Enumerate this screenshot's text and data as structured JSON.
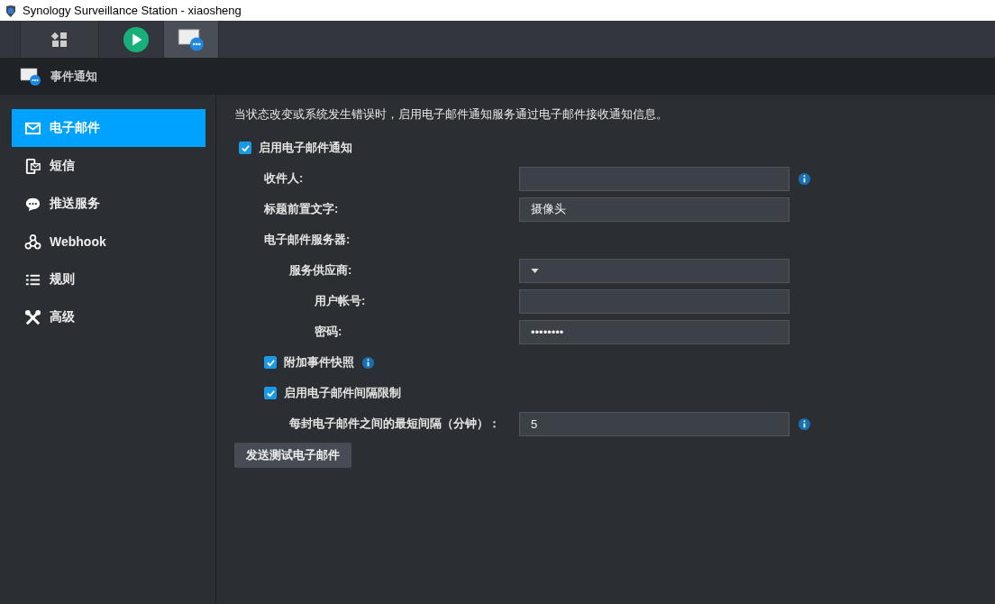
{
  "window": {
    "title": "Synology Surveillance Station - xiaosheng"
  },
  "app_tabs": [
    {
      "selected": false
    },
    {
      "selected": false
    },
    {
      "selected": true
    }
  ],
  "header": {
    "title": "事件通知"
  },
  "sidebar": {
    "items": [
      {
        "label": "电子邮件",
        "selected": true
      },
      {
        "label": "短信",
        "selected": false
      },
      {
        "label": "推送服务",
        "selected": false
      },
      {
        "label": "Webhook",
        "selected": false
      },
      {
        "label": "规则",
        "selected": false
      },
      {
        "label": "高级",
        "selected": false
      }
    ]
  },
  "content": {
    "description": "当状态改变或系统发生错误时，启用电子邮件通知服务通过电子邮件接收通知信息。",
    "form": [
      {
        "kind": "checkbox",
        "label": "启用电子邮件通知",
        "checked": true,
        "children": [
          {
            "kind": "field",
            "label": "收件人:",
            "info": true
          },
          {
            "kind": "field",
            "label": "标题前置文字:",
            "value": "摄像头"
          },
          {
            "kind": "heading",
            "label": "电子邮件服务器:",
            "children": [
              {
                "kind": "select",
                "label": "服务供应商:",
                "children": [
                  {
                    "kind": "field",
                    "label": "用户帐号:"
                  },
                  {
                    "kind": "field",
                    "label": "密码:",
                    "value": "••••••••"
                  }
                ]
              }
            ]
          },
          {
            "kind": "checkbox",
            "label": "附加事件快照",
            "checked": true,
            "info": true
          },
          {
            "kind": "checkbox",
            "label": "启用电子邮件间隔限制",
            "checked": true,
            "children": [
              {
                "kind": "field",
                "label": "每封电子邮件之间的最短间隔（分钟）：",
                "value": "5",
                "info": true
              }
            ]
          }
        ]
      }
    ],
    "button": "发送测试电子邮件"
  }
}
